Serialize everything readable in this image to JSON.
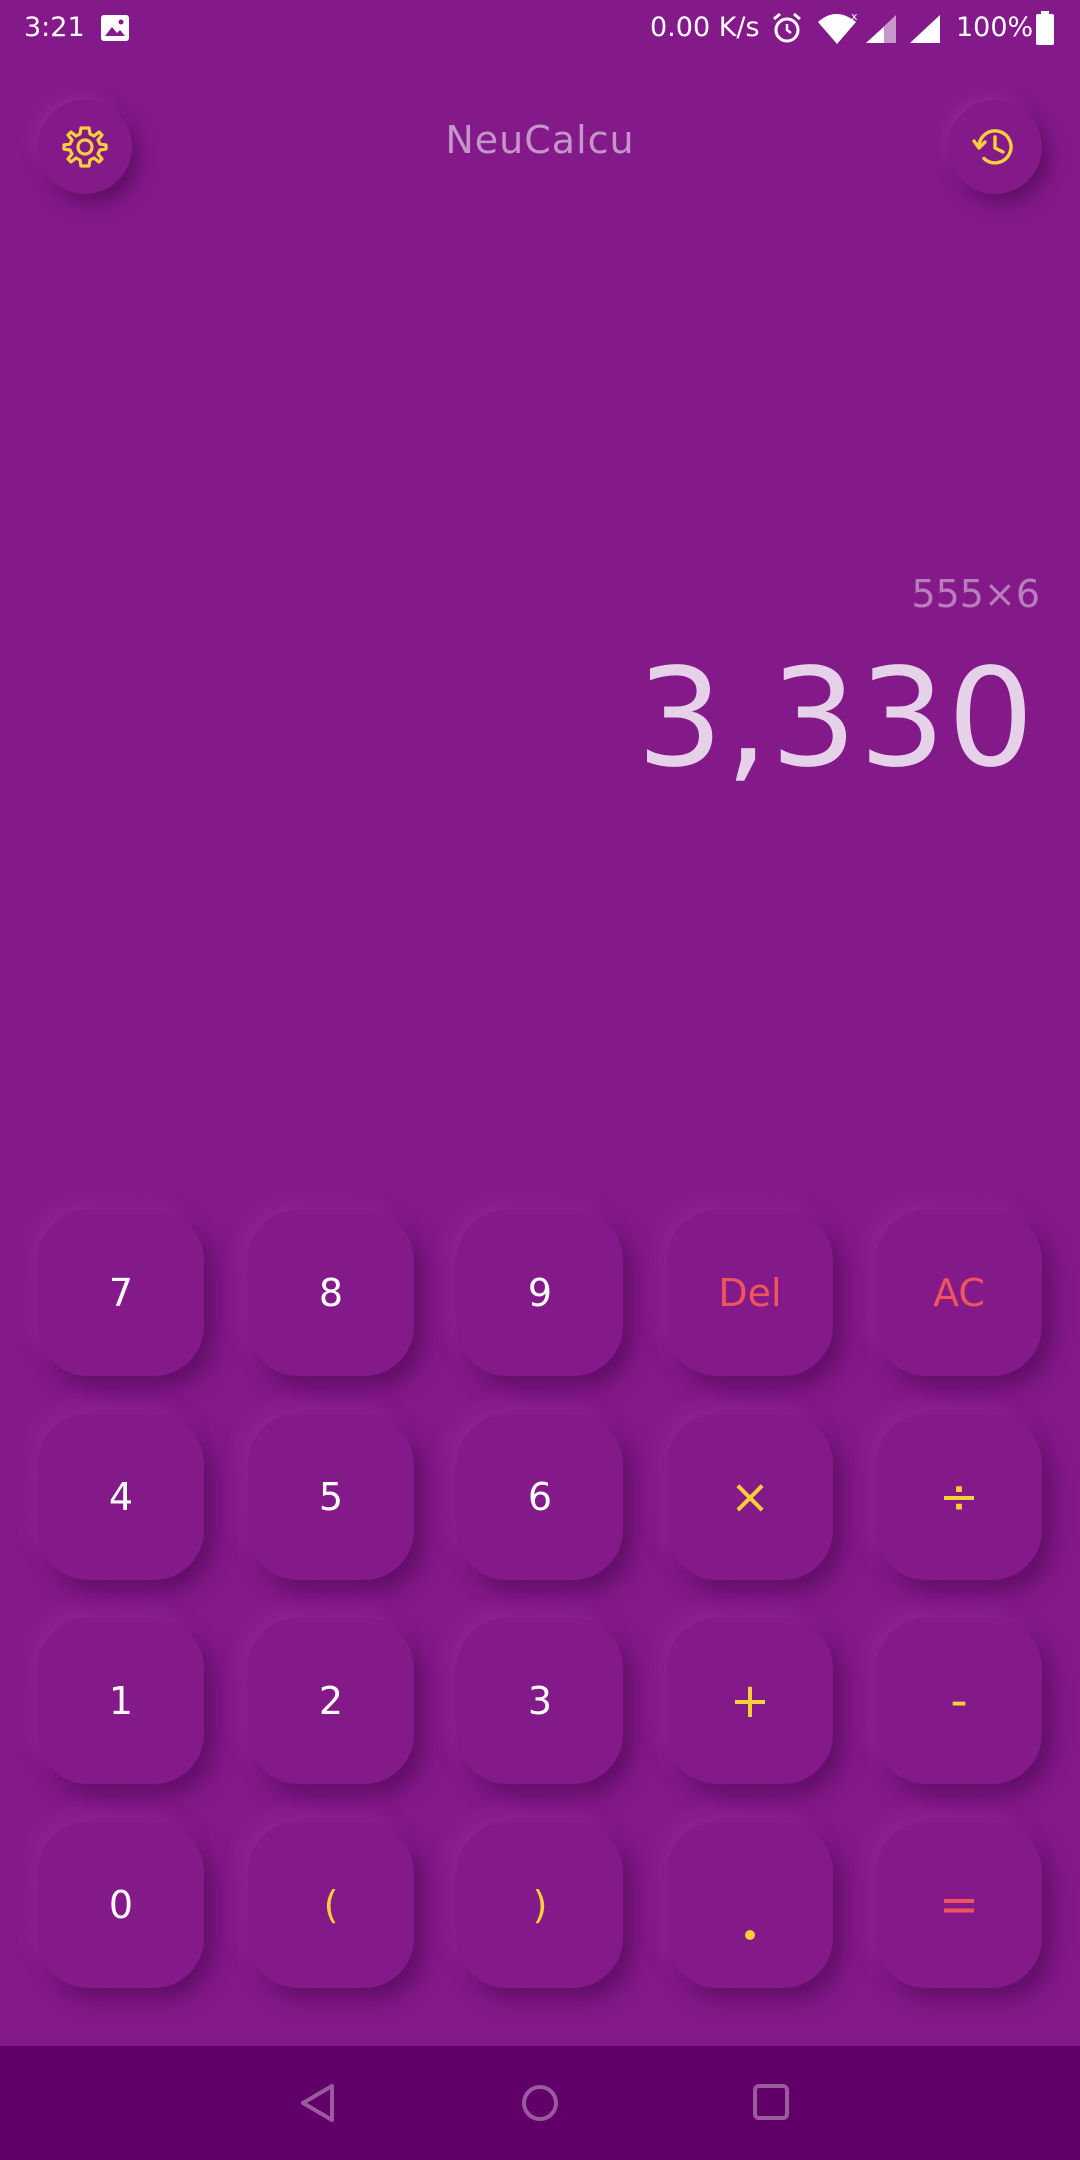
{
  "status_bar": {
    "time": "3:21",
    "net_speed": "0.00 K/s",
    "battery": "100%",
    "icons": [
      "gallery-icon",
      "alarm-icon",
      "wifi-icon",
      "signal-icon",
      "battery-icon"
    ]
  },
  "header": {
    "title": "NeuCalcu",
    "settings_icon": "gear-icon",
    "history_icon": "history-icon"
  },
  "display": {
    "expression": "555×6",
    "result": "3,330"
  },
  "keypad": {
    "row1": [
      "7",
      "8",
      "9",
      "Del",
      "AC"
    ],
    "row2": [
      "4",
      "5",
      "6",
      "×",
      "÷"
    ],
    "row3": [
      "1",
      "2",
      "3",
      "+",
      "-"
    ],
    "row4": [
      "0",
      "(",
      ")",
      ".",
      "="
    ]
  },
  "nav_bar": {
    "icons": [
      "back-icon",
      "home-icon",
      "recents-icon"
    ]
  },
  "colors": {
    "background": "#84198a",
    "accent_yellow": "#f7cf3a",
    "accent_red": "#f2545b",
    "result_text": "#e6d2e8",
    "nav_bar": "#620069"
  }
}
